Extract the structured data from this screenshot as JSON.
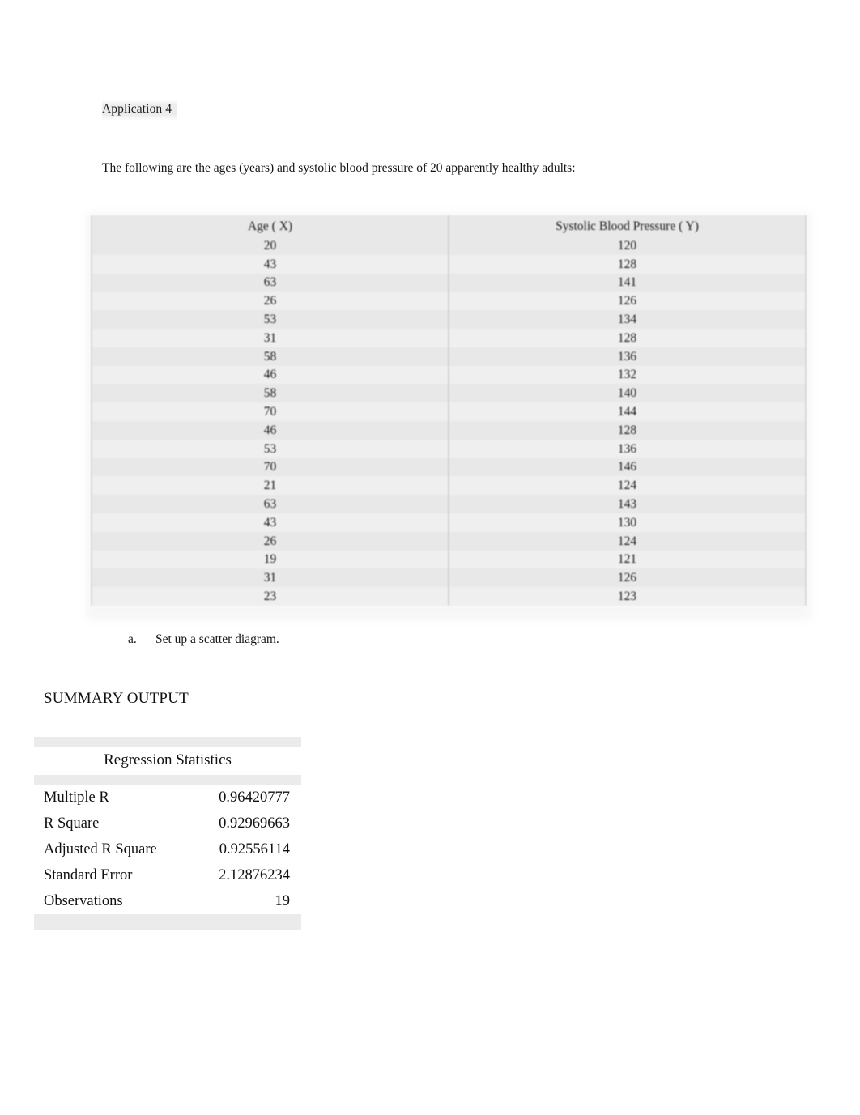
{
  "document": {
    "title": "Application 4",
    "intro": "The following are the ages (years) and systolic blood pressure of 20 apparently healthy adults:",
    "question": {
      "marker": "a.",
      "text": "Set up a scatter diagram."
    },
    "summary_heading": "SUMMARY OUTPUT"
  },
  "data_table": {
    "headers": [
      "Age ( X)",
      "Systolic Blood Pressure ( Y)"
    ],
    "rows": [
      [
        "20",
        "120"
      ],
      [
        "43",
        "128"
      ],
      [
        "63",
        "141"
      ],
      [
        "26",
        "126"
      ],
      [
        "53",
        "134"
      ],
      [
        "31",
        "128"
      ],
      [
        "58",
        "136"
      ],
      [
        "46",
        "132"
      ],
      [
        "58",
        "140"
      ],
      [
        "70",
        "144"
      ],
      [
        "46",
        "128"
      ],
      [
        "53",
        "136"
      ],
      [
        "70",
        "146"
      ],
      [
        "21",
        "124"
      ],
      [
        "63",
        "143"
      ],
      [
        "43",
        "130"
      ],
      [
        "26",
        "124"
      ],
      [
        "19",
        "121"
      ],
      [
        "31",
        "126"
      ],
      [
        "23",
        "123"
      ]
    ]
  },
  "regression_statistics": {
    "title": "Regression Statistics",
    "rows": [
      {
        "label": "Multiple R",
        "value": "0.96420777"
      },
      {
        "label": "R Square",
        "value": "0.92969663"
      },
      {
        "label": "Adjusted R Square",
        "value": "0.92556114"
      },
      {
        "label": "Standard Error",
        "value": "2.12876234"
      },
      {
        "label": "Observations",
        "value": "19"
      }
    ]
  },
  "chart_data": {
    "type": "table",
    "title": "Ages and systolic blood pressure of 20 apparently healthy adults",
    "xlabel": "Age ( X)",
    "ylabel": "Systolic Blood Pressure ( Y)",
    "x": [
      20,
      43,
      63,
      26,
      53,
      31,
      58,
      46,
      58,
      70,
      46,
      53,
      70,
      21,
      63,
      43,
      26,
      19,
      31,
      23
    ],
    "y": [
      120,
      128,
      141,
      126,
      134,
      128,
      136,
      132,
      140,
      144,
      128,
      136,
      146,
      124,
      143,
      130,
      124,
      121,
      126,
      123
    ],
    "n": 20,
    "regression": {
      "multiple_r": 0.96420777,
      "r_square": 0.92969663,
      "adjusted_r_square": 0.92556114,
      "standard_error": 2.12876234,
      "observations": 19
    }
  }
}
